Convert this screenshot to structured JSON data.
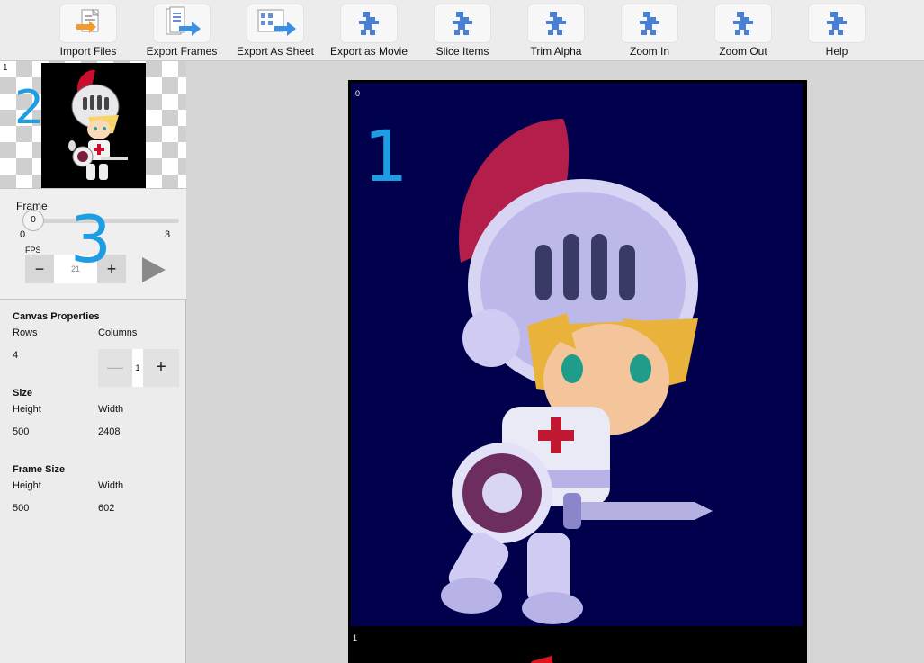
{
  "toolbar": {
    "buttons": [
      {
        "label": "Import Files",
        "icon": "import-files-icon"
      },
      {
        "label": "Export Frames",
        "icon": "export-frames-icon"
      },
      {
        "label": "Export As Sheet",
        "icon": "export-sheet-icon"
      },
      {
        "label": "Export as Movie",
        "icon": "export-movie-icon"
      },
      {
        "label": "Slice Items",
        "icon": "slice-items-icon"
      },
      {
        "label": "Trim Alpha",
        "icon": "trim-alpha-icon"
      },
      {
        "label": "Zoom In",
        "icon": "zoom-in-icon"
      },
      {
        "label": "Zoom Out",
        "icon": "zoom-out-icon"
      },
      {
        "label": "Help",
        "icon": "help-icon"
      }
    ]
  },
  "thumbnail": {
    "index": "1",
    "annotation": "2"
  },
  "player": {
    "frame_label": "Frame",
    "slider_value": "0",
    "slider_min": "0",
    "slider_max": "3",
    "annotation": "3",
    "fps_label": "FPS",
    "fps_value": "21",
    "minus": "−",
    "plus": "+"
  },
  "canvas_properties": {
    "title": "Canvas Properties",
    "rows_label": "Rows",
    "columns_label": "Columns",
    "rows_value": "4",
    "columns_value": "1",
    "minus": "—",
    "plus": "+"
  },
  "size": {
    "title": "Size",
    "height_label": "Height",
    "width_label": "Width",
    "height_value": "500",
    "width_value": "2408"
  },
  "frame_size": {
    "title": "Frame Size",
    "height_label": "Height",
    "width_label": "Width",
    "height_value": "500",
    "width_value": "602"
  },
  "canvas": {
    "frames": [
      {
        "index": "0"
      },
      {
        "index": "1"
      }
    ],
    "annotation": "1",
    "frame_background": "#00004c"
  }
}
